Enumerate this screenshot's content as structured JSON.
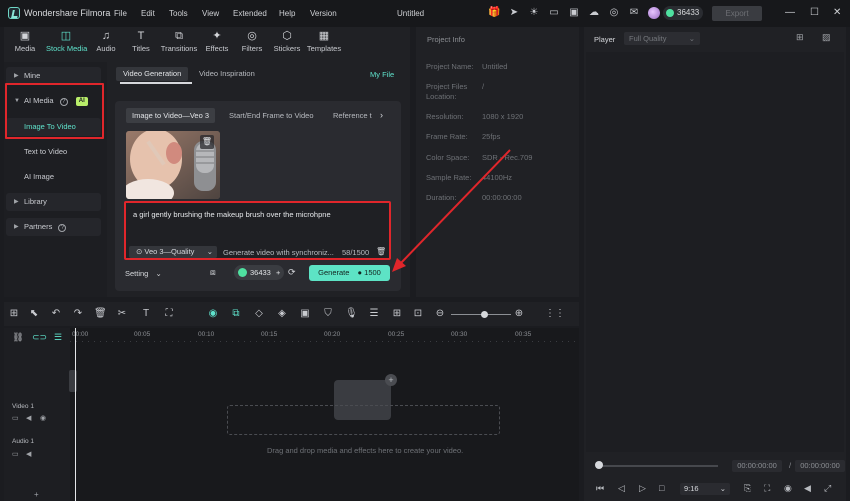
{
  "titlebar": {
    "app_name": "Wondershare Filmora",
    "menus": [
      "File",
      "Edit",
      "Tools",
      "View",
      "Extended",
      "Help",
      "Version"
    ],
    "document_title": "Untitled",
    "credits": "36433",
    "export_label": "Export"
  },
  "media_tabs": [
    {
      "label": "Media",
      "icon": "media-icon"
    },
    {
      "label": "Stock Media",
      "icon": "stock-media-icon"
    },
    {
      "label": "Audio",
      "icon": "audio-icon"
    },
    {
      "label": "Titles",
      "icon": "titles-icon"
    },
    {
      "label": "Transitions",
      "icon": "transitions-icon"
    },
    {
      "label": "Effects",
      "icon": "effects-icon"
    },
    {
      "label": "Filters",
      "icon": "filters-icon"
    },
    {
      "label": "Stickers",
      "icon": "stickers-icon"
    },
    {
      "label": "Templates",
      "icon": "templates-icon"
    }
  ],
  "sidebar": {
    "mine": "Mine",
    "ai_media": "AI Media",
    "ai_badge": "AI",
    "image_to_video": "Image To Video",
    "text_to_video": "Text to Video",
    "ai_image": "AI Image",
    "library": "Library",
    "partners": "Partners"
  },
  "generation": {
    "tab_active": "Video Generation",
    "tab_inactive": "Video Inspiration",
    "my_file": "My File",
    "subtabs": [
      "Image to Video—Veo 3",
      "Start/End Frame to Video",
      "Reference t"
    ],
    "prompt": "a girl gently brushing the makeup brush over the microhpne",
    "model": "Veo 3—Quality",
    "sync_text": "Generate video with synchroniz...",
    "char_count": "58/1500",
    "setting_label": "Setting",
    "credits": "36433",
    "generate_label": "Generate",
    "generate_cost": "1500"
  },
  "project_info": {
    "heading": "Project Info",
    "rows": [
      {
        "label": "Project Name:",
        "value": "Untitled"
      },
      {
        "label": "Project Files Location:",
        "value": "/"
      },
      {
        "label": "Resolution:",
        "value": "1080 x 1920"
      },
      {
        "label": "Frame Rate:",
        "value": "25fps"
      },
      {
        "label": "Color Space:",
        "value": "SDR - Rec.709"
      },
      {
        "label": "Sample Rate:",
        "value": "44100Hz"
      },
      {
        "label": "Duration:",
        "value": "00:00:00:00"
      }
    ]
  },
  "player": {
    "label": "Player",
    "quality": "Full Quality",
    "current_time": "00:00:00:00",
    "separator": "/",
    "total_time": "00:00:00:00",
    "ratio": "9:16"
  },
  "timeline": {
    "ruler": [
      "00:00",
      "00:05",
      "00:10",
      "00:15",
      "00:20",
      "00:25",
      "00:30",
      "00:35"
    ],
    "video_track": "Video 1",
    "audio_track": "Audio 1",
    "drop_text": "Drag and drop media and effects here to create your video."
  },
  "colors": {
    "accent": "#5de3c5",
    "highlight_box": "#e0262b",
    "arrow": "#e0262b",
    "ai_badge": "#b9ee6a"
  }
}
